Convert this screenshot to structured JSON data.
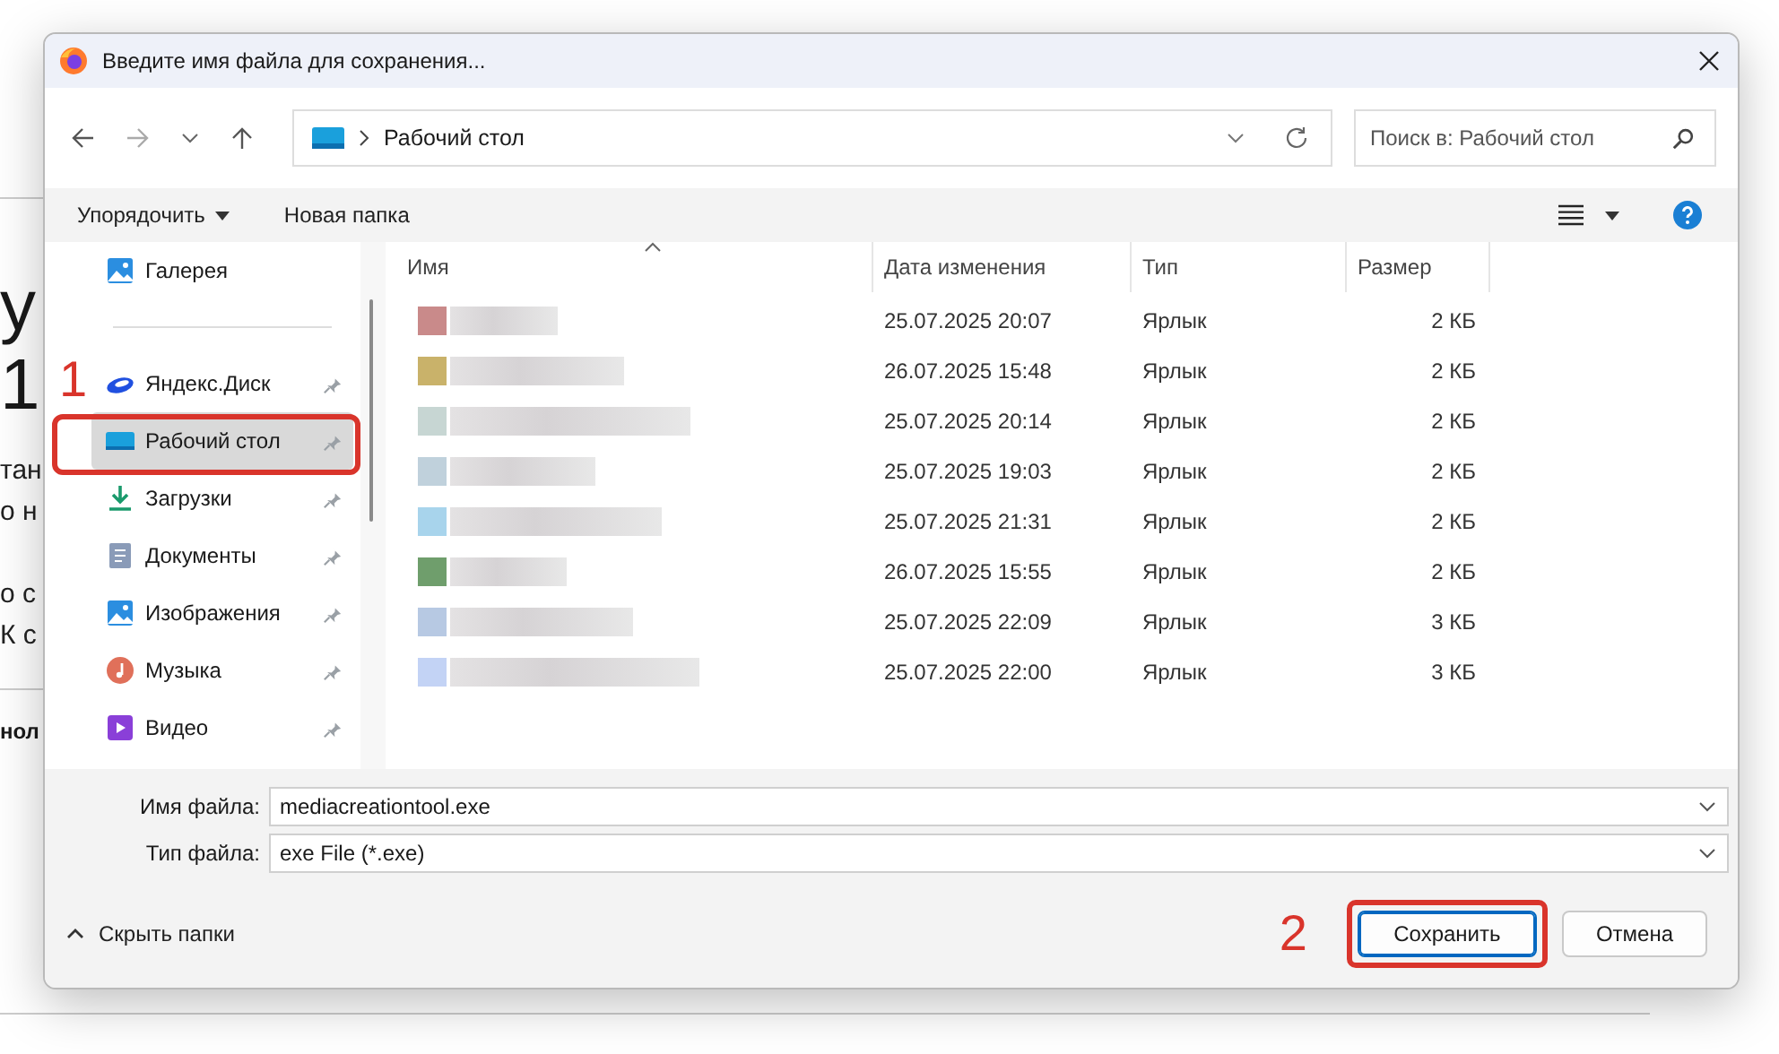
{
  "background_page": {
    "fragments": [
      {
        "kind": "heading",
        "text": "у"
      },
      {
        "kind": "heading",
        "text": "1"
      },
      {
        "kind": "para",
        "text": "тан"
      },
      {
        "kind": "para",
        "text": "о н"
      },
      {
        "kind": "gap"
      },
      {
        "kind": "para",
        "text": "о с"
      },
      {
        "kind": "para",
        "text": "К с"
      },
      {
        "kind": "rule"
      },
      {
        "kind": "bold",
        "text": "нол"
      }
    ]
  },
  "dialog": {
    "title": "Введите имя файла для сохранения...",
    "address": {
      "path": "Рабочий стол"
    },
    "search": {
      "placeholder": "Поиск в: Рабочий стол"
    },
    "toolbar": [
      {
        "label": "Упорядочить",
        "kind": "menu"
      },
      {
        "label": "Новая папка",
        "kind": "plain"
      }
    ],
    "sidebar": {
      "groups": [
        [
          {
            "label": "Галерея",
            "kind": "gallery",
            "pinned": false,
            "selected": false
          }
        ],
        [
          {
            "label": "Яндекс.Диск",
            "kind": "cloud",
            "pinned": true,
            "selected": false
          },
          {
            "label": "Рабочий стол",
            "kind": "desktop",
            "pinned": true,
            "selected": true
          },
          {
            "label": "Загрузки",
            "kind": "downloads",
            "pinned": true,
            "selected": false
          },
          {
            "label": "Документы",
            "kind": "documents",
            "pinned": true,
            "selected": false
          },
          {
            "label": "Изображения",
            "kind": "pictures",
            "pinned": true,
            "selected": false
          },
          {
            "label": "Музыка",
            "kind": "music",
            "pinned": true,
            "selected": false
          },
          {
            "label": "Видео",
            "kind": "video",
            "pinned": true,
            "selected": false
          }
        ]
      ]
    },
    "table": {
      "columns": [
        "Имя",
        "Дата изменения",
        "Тип",
        "Размер"
      ],
      "rows": [
        {
          "color": "#c98a8a",
          "date": "25.07.2025 20:07",
          "type": "Ярлык",
          "size": "2 КБ"
        },
        {
          "color": "#c9b26a",
          "date": "26.07.2025 15:48",
          "type": "Ярлык",
          "size": "2 КБ"
        },
        {
          "color": "#c7d6d3",
          "date": "25.07.2025 20:14",
          "type": "Ярлык",
          "size": "2 КБ"
        },
        {
          "color": "#c0d1dc",
          "date": "25.07.2025 19:03",
          "type": "Ярлык",
          "size": "2 КБ"
        },
        {
          "color": "#a8d4ec",
          "date": "25.07.2025 21:31",
          "type": "Ярлык",
          "size": "2 КБ"
        },
        {
          "color": "#6f9e6c",
          "date": "26.07.2025 15:55",
          "type": "Ярлык",
          "size": "2 КБ"
        },
        {
          "color": "#b7c9e3",
          "date": "25.07.2025 22:09",
          "type": "Ярлык",
          "size": "3 КБ"
        },
        {
          "color": "#c3d3f5",
          "date": "25.07.2025 22:00",
          "type": "Ярлык",
          "size": "3 КБ"
        }
      ]
    },
    "filename": {
      "label": "Имя файла:",
      "value": "mediacreationtool.exe"
    },
    "filetype": {
      "label": "Тип файла:",
      "value": "exe File (*.exe)"
    },
    "hide_folders": "Скрыть папки",
    "buttons": [
      {
        "label": "Сохранить",
        "default": true
      },
      {
        "label": "Отмена",
        "default": false
      }
    ]
  },
  "annotations": {
    "sidebar_marker": "1",
    "save_marker": "2"
  }
}
